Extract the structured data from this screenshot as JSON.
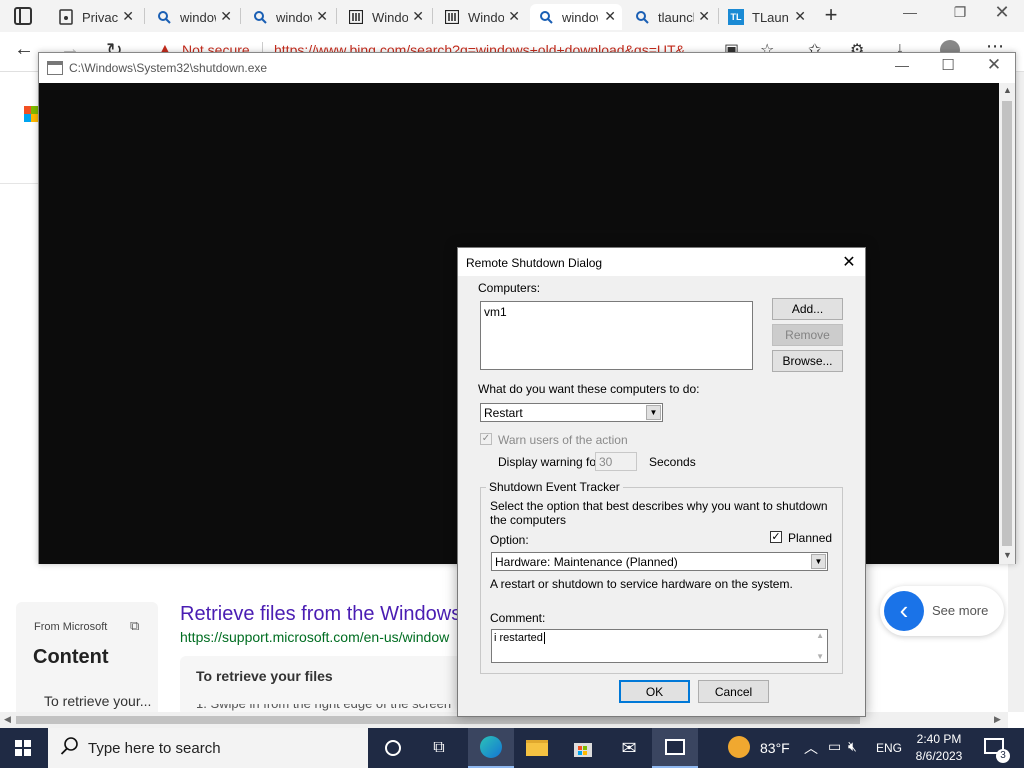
{
  "browser": {
    "tabs": [
      {
        "label": "Privacy",
        "icon": "page-lock-icon"
      },
      {
        "label": "windows",
        "icon": "search-icon"
      },
      {
        "label": "windows",
        "icon": "search-icon"
      },
      {
        "label": "Windows",
        "icon": "museum-icon"
      },
      {
        "label": "Windows",
        "icon": "museum-icon"
      },
      {
        "label": "windows",
        "icon": "search-icon"
      },
      {
        "label": "tlauncher",
        "icon": "search-icon"
      },
      {
        "label": "TLauncher",
        "icon": "tl-icon"
      }
    ],
    "address": {
      "security": "Not secure",
      "url": "https://www.bing.com/search?q=windows+old+download&qs=UT&"
    }
  },
  "bing": {
    "result_title": "Retrieve files from the Windows",
    "result_url": "https://support.microsoft.com/en-us/window",
    "snippet_heading": "To retrieve your files",
    "snippet_line": "1. Swipe in from the right edge of the screen",
    "side_source": "From Microsoft",
    "side_title": "Content",
    "side_text": "To retrieve your...",
    "see_more": "See more"
  },
  "console": {
    "title": "C:\\Windows\\System32\\shutdown.exe"
  },
  "dialog": {
    "title": "Remote Shutdown Dialog",
    "computers_label": "Computers:",
    "computers": [
      "vm1"
    ],
    "add_button": "Add...",
    "remove_button": "Remove",
    "browse_button": "Browse...",
    "action_label": "What do you want these computers to do:",
    "action_value": "Restart",
    "warn_label": "Warn users of the action",
    "warn_checked": true,
    "display_warning_label": "Display warning for",
    "warning_seconds": "30",
    "seconds_label": "Seconds",
    "tracker": {
      "group_label": "Shutdown Event Tracker",
      "description": "Select the option that best describes why you want to shutdown the computers",
      "option_label": "Option:",
      "planned_label": "Planned",
      "planned_checked": true,
      "option_value": "Hardware: Maintenance (Planned)",
      "option_description": "A restart or shutdown to service hardware on the system.",
      "comment_label": "Comment:",
      "comment_value": "i restarted"
    },
    "ok_button": "OK",
    "cancel_button": "Cancel"
  },
  "taskbar": {
    "search_placeholder": "Type here to search",
    "weather": "83°F",
    "language": "ENG",
    "time": "2:40 PM",
    "date": "8/6/2023",
    "notification_count": "3"
  },
  "colors": {
    "taskbar_bg": "#1f2a44",
    "bing_link": "#4a1db3",
    "url_green": "#006d21",
    "warning_red": "#c42b1c"
  }
}
